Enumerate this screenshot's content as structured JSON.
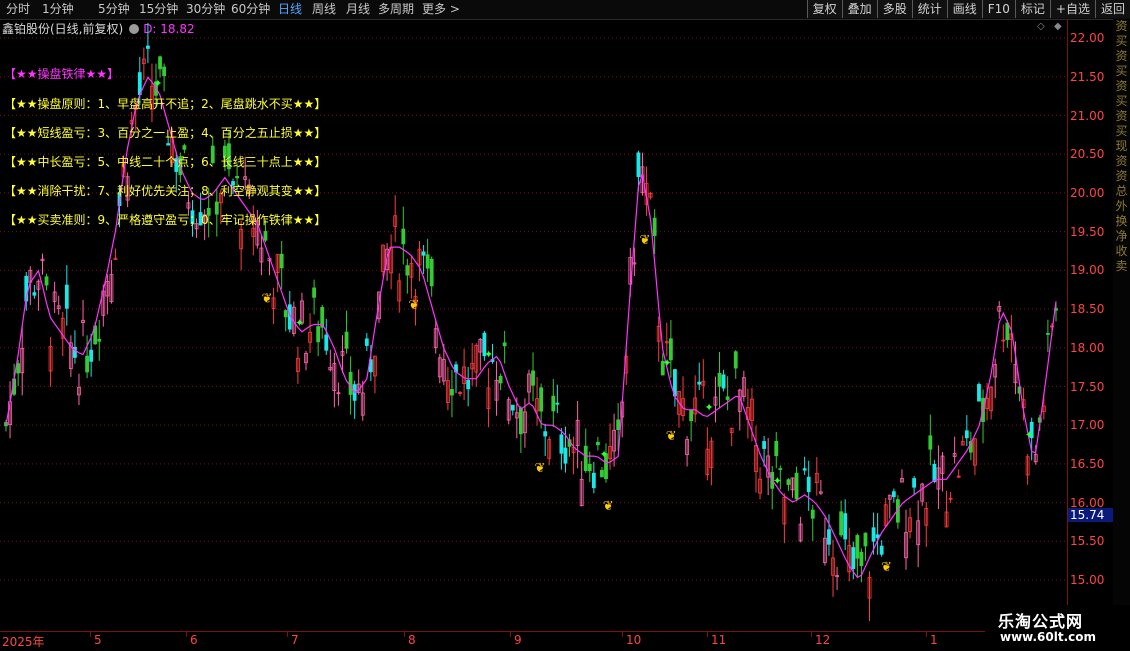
{
  "toolbar": {
    "periods": [
      "分时",
      "1分钟",
      "5分钟",
      "15分钟",
      "30分钟",
      "60分钟",
      "日线",
      "周线",
      "月线",
      "多周期",
      "更多 >"
    ],
    "active_period": "日线",
    "right_buttons": [
      "复权",
      "叠加",
      "多股",
      "统计",
      "画线",
      "F10",
      "标记",
      "+自选",
      "返回"
    ]
  },
  "info": {
    "stock": "鑫铂股份(日线,前复权)",
    "d_label": "D: 18.82"
  },
  "overlay": {
    "title": "【★★操盘铁律★★】",
    "lines": [
      "【★★操盘原则：1、早盘高开不追；2、尾盘跳水不买★★】",
      "【★★短线盈亏：3、百分之一止盈；4、百分之五止损★★】",
      "【★★中长盈亏：5、中线二十个点；6、长线三十点上★★】",
      "【★★消除干扰：7、利好优先关注；8、利空静观其变★★】",
      "【★★买卖准则：9、严格遵守盈亏；0、牢记操作铁律★★】"
    ]
  },
  "y_axis": {
    "labels": [
      "22.00",
      "21.50",
      "21.00",
      "20.50",
      "20.00",
      "19.50",
      "19.00",
      "18.50",
      "18.00",
      "17.50",
      "17.00",
      "16.50",
      "16.00",
      "15.50",
      "15.00"
    ],
    "current_price": "15.74"
  },
  "x_axis": {
    "labels": [
      "2025年",
      "5",
      "6",
      "7",
      "8",
      "9",
      "10",
      "11",
      "12",
      "1"
    ]
  },
  "right_strip_chars": [
    "资",
    "买",
    "资",
    "买",
    "资",
    "买",
    "资",
    "买",
    "现",
    "资",
    "资",
    "总",
    "外",
    "换",
    "净",
    "收",
    "卖"
  ],
  "watermark": {
    "line1": "乐淘公式网",
    "line2": "www.60lt.com"
  },
  "colors": {
    "up": "#ff3b3b",
    "down": "#19e8e8",
    "up_pink": "#ff66aa",
    "down_green": "#33cc33",
    "ma_line": "#ff33ff",
    "grid": "#7a1010",
    "active_tab": "#4ea8ff",
    "overlay_text": "#ffff33"
  },
  "chart_data": {
    "type": "candlestick",
    "y_range": [
      14.6,
      22.1
    ],
    "ma_line": [
      17.0,
      17.8,
      18.8,
      19.0,
      18.4,
      18.2,
      18.0,
      17.9,
      18.2,
      18.8,
      19.5,
      20.5,
      21.2,
      21.5,
      21.3,
      20.8,
      20.3,
      20.0,
      19.9,
      20.0,
      20.2,
      20.0,
      19.8,
      19.6,
      19.2,
      18.8,
      18.4,
      18.2,
      18.3,
      18.3,
      18.0,
      17.6,
      17.4,
      17.6,
      18.5,
      19.3,
      19.3,
      19.2,
      19.0,
      18.5,
      18.0,
      17.7,
      17.6,
      17.6,
      17.8,
      17.9,
      17.5,
      17.2,
      17.3,
      17.0,
      17.0,
      16.9,
      16.7,
      16.6,
      16.6,
      16.5,
      16.6,
      18.6,
      20.4,
      19.6,
      18.0,
      17.4,
      17.2,
      17.2,
      17.1,
      17.2,
      17.3,
      17.4,
      17.0,
      16.6,
      16.3,
      16.1,
      16.0,
      16.1,
      16.0,
      15.8,
      15.5,
      15.2,
      15.0,
      15.3,
      15.6,
      15.8,
      16.0,
      16.1,
      16.2,
      16.3,
      16.3,
      16.5,
      16.7,
      17.0,
      17.6,
      18.5,
      18.2,
      17.2,
      16.5,
      17.5,
      18.6
    ]
  }
}
